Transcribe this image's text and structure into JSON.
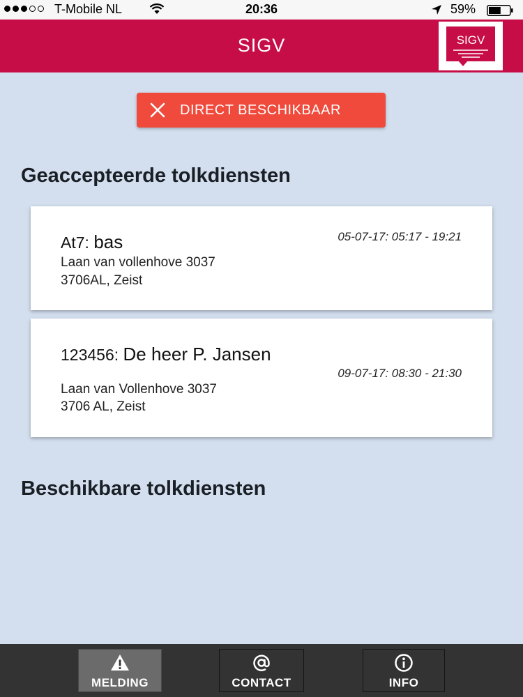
{
  "status_bar": {
    "carrier": "T-Mobile NL",
    "time": "20:36",
    "battery_percent": "59%",
    "battery_level": 0.59
  },
  "header": {
    "title": "SIGV",
    "logo_text": "SIGV",
    "brand_color": "#c70d48"
  },
  "direct_button": {
    "label": "DIRECT BESCHIKBAAR",
    "color": "#ef4a3b",
    "icon": "close-icon"
  },
  "sections": {
    "accepted_title": "Geaccepteerde tolkdiensten",
    "available_title": "Beschikbare tolkdiensten"
  },
  "accepted_services": [
    {
      "code": "At7: ",
      "name": "bas",
      "time": "05-07-17: 05:17 - 19:21",
      "address_line1": "Laan van vollenhove 3037",
      "address_line2": "3706AL, Zeist"
    },
    {
      "code": "123456: ",
      "name": "De heer P. Jansen",
      "time": "09-07-17: 08:30 - 21:30",
      "address_line1": "Laan van Vollenhove 3037",
      "address_line2": "3706 AL, Zeist"
    }
  ],
  "tabs": [
    {
      "label": "MELDING",
      "icon": "warning-icon",
      "active": true
    },
    {
      "label": "CONTACT",
      "icon": "at-sign-icon",
      "active": false
    },
    {
      "label": "INFO",
      "icon": "info-icon",
      "active": false
    }
  ]
}
